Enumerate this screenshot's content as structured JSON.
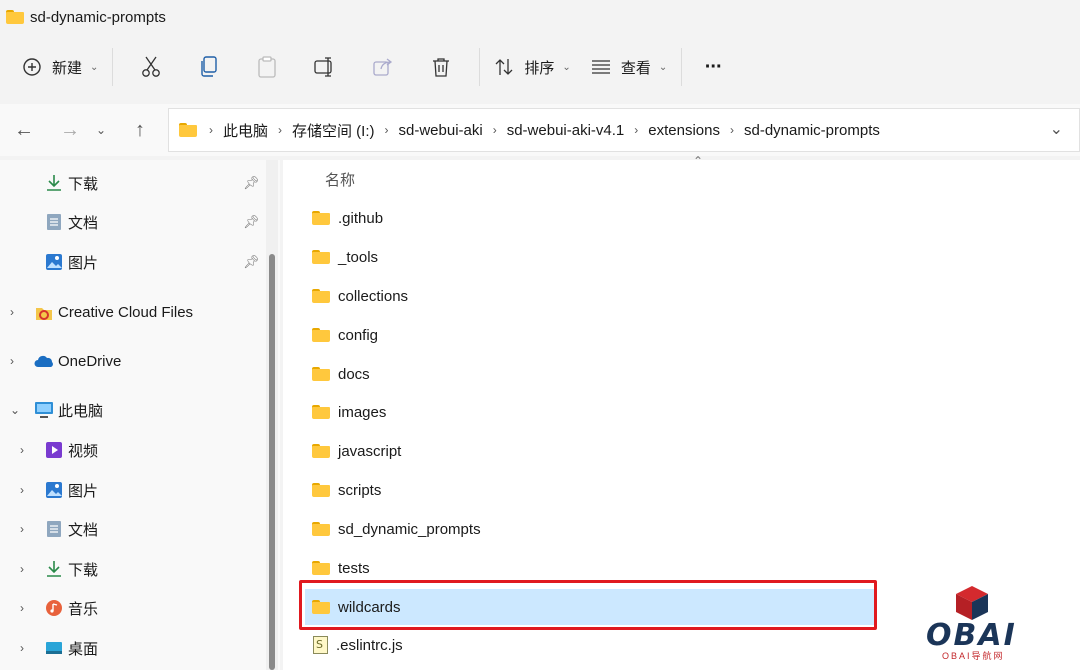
{
  "window": {
    "title": "sd-dynamic-prompts"
  },
  "toolbar": {
    "new_label": "新建",
    "sort_label": "排序",
    "view_label": "查看",
    "more_label": "···"
  },
  "address": {
    "crumbs": [
      "此电脑",
      "存储空间 (I:)",
      "sd-webui-aki",
      "sd-webui-aki-v4.1",
      "extensions",
      "sd-dynamic-prompts"
    ]
  },
  "sidebar": {
    "quick_access": [
      {
        "label": "下载",
        "icon": "download-icon"
      },
      {
        "label": "文档",
        "icon": "document-icon"
      },
      {
        "label": "图片",
        "icon": "pictures-icon"
      }
    ],
    "roots": [
      {
        "label": "Creative Cloud Files",
        "icon": "creative-cloud-icon"
      },
      {
        "label": "OneDrive",
        "icon": "onedrive-icon"
      },
      {
        "label": "此电脑",
        "icon": "this-pc-icon"
      }
    ],
    "pc_children": [
      {
        "label": "视频",
        "icon": "videos-icon"
      },
      {
        "label": "图片",
        "icon": "pictures-icon"
      },
      {
        "label": "文档",
        "icon": "document-icon"
      },
      {
        "label": "下载",
        "icon": "download-icon"
      },
      {
        "label": "音乐",
        "icon": "music-icon"
      },
      {
        "label": "桌面",
        "icon": "desktop-icon"
      }
    ]
  },
  "content": {
    "column_header": "名称",
    "items": [
      {
        "name": ".github",
        "type": "folder"
      },
      {
        "name": "_tools",
        "type": "folder"
      },
      {
        "name": "collections",
        "type": "folder"
      },
      {
        "name": "config",
        "type": "folder"
      },
      {
        "name": "docs",
        "type": "folder"
      },
      {
        "name": "images",
        "type": "folder"
      },
      {
        "name": "javascript",
        "type": "folder"
      },
      {
        "name": "scripts",
        "type": "folder"
      },
      {
        "name": "sd_dynamic_prompts",
        "type": "folder"
      },
      {
        "name": "tests",
        "type": "folder"
      },
      {
        "name": "wildcards",
        "type": "folder",
        "selected": true
      },
      {
        "name": ".eslintrc.js",
        "type": "file"
      }
    ]
  },
  "watermark": {
    "logo_text": "OBAI",
    "sub_text": "OBAI导航网"
  },
  "colors": {
    "selection": "#cce8ff",
    "highlight_border": "#e0191f",
    "folder": "#ffc83d"
  }
}
